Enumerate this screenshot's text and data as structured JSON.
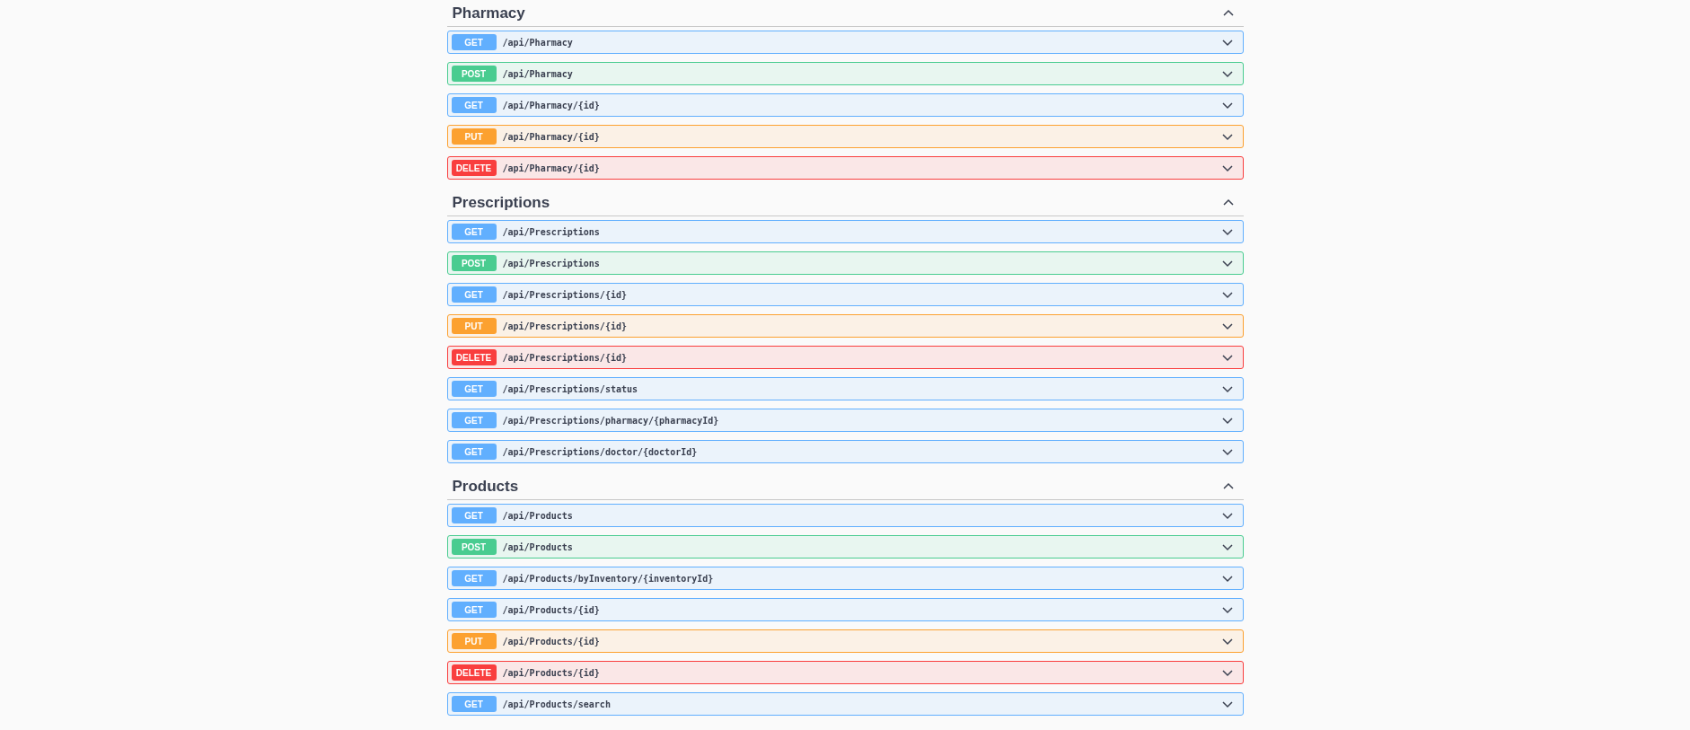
{
  "sections": [
    {
      "title": "Pharmacy",
      "expanded": true,
      "operations": [
        {
          "kind": "get",
          "method": "GET",
          "path": "/api/Pharmacy",
          "expanded": false
        },
        {
          "kind": "post",
          "method": "POST",
          "path": "/api/Pharmacy",
          "expanded": false
        },
        {
          "kind": "get",
          "method": "GET",
          "path": "/api/Pharmacy/{id}",
          "expanded": false
        },
        {
          "kind": "put",
          "method": "PUT",
          "path": "/api/Pharmacy/{id}",
          "expanded": false
        },
        {
          "kind": "delete",
          "method": "DELETE",
          "path": "/api/Pharmacy/{id}",
          "expanded": false
        }
      ]
    },
    {
      "title": "Prescriptions",
      "expanded": true,
      "operations": [
        {
          "kind": "get",
          "method": "GET",
          "path": "/api/Prescriptions",
          "expanded": false
        },
        {
          "kind": "post",
          "method": "POST",
          "path": "/api/Prescriptions",
          "expanded": false
        },
        {
          "kind": "get",
          "method": "GET",
          "path": "/api/Prescriptions/{id}",
          "expanded": false
        },
        {
          "kind": "put",
          "method": "PUT",
          "path": "/api/Prescriptions/{id}",
          "expanded": false
        },
        {
          "kind": "delete",
          "method": "DELETE",
          "path": "/api/Prescriptions/{id}",
          "expanded": false
        },
        {
          "kind": "get",
          "method": "GET",
          "path": "/api/Prescriptions/status",
          "expanded": false
        },
        {
          "kind": "get",
          "method": "GET",
          "path": "/api/Prescriptions/pharmacy/{pharmacyId}",
          "expanded": false
        },
        {
          "kind": "get",
          "method": "GET",
          "path": "/api/Prescriptions/doctor/{doctorId}",
          "expanded": false
        }
      ]
    },
    {
      "title": "Products",
      "expanded": true,
      "operations": [
        {
          "kind": "get",
          "method": "GET",
          "path": "/api/Products",
          "expanded": false
        },
        {
          "kind": "post",
          "method": "POST",
          "path": "/api/Products",
          "expanded": false
        },
        {
          "kind": "get",
          "method": "GET",
          "path": "/api/Products/byInventory/{inventoryId}",
          "expanded": false
        },
        {
          "kind": "get",
          "method": "GET",
          "path": "/api/Products/{id}",
          "expanded": false
        },
        {
          "kind": "put",
          "method": "PUT",
          "path": "/api/Products/{id}",
          "expanded": false
        },
        {
          "kind": "delete",
          "method": "DELETE",
          "path": "/api/Products/{id}",
          "expanded": false
        },
        {
          "kind": "get",
          "method": "GET",
          "path": "/api/Products/search",
          "expanded": false
        }
      ]
    }
  ]
}
